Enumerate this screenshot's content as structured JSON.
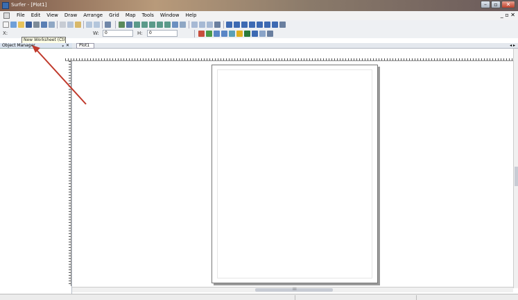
{
  "window": {
    "title": "Surfer - [Plot1]",
    "controls": {
      "minimize": "–",
      "maximize": "▫",
      "close": "✕"
    }
  },
  "menubar": {
    "items": [
      "File",
      "Edit",
      "View",
      "Draw",
      "Arrange",
      "Grid",
      "Map",
      "Tools",
      "Window",
      "Help"
    ],
    "mdi_controls": "_ ▫ ✕"
  },
  "toolbar2": {
    "x_label": "X:",
    "w_label": "W:",
    "w_value": "0",
    "h_label": "H:",
    "h_value": "0"
  },
  "tooltip": {
    "text": "New Worksheet (Ctrl+W)"
  },
  "object_manager": {
    "title": "Object Manager",
    "pin": "ᵩ",
    "close": "✕"
  },
  "document": {
    "tab_label": "Plot1",
    "tab_scroll": "◂ ▸"
  },
  "colors": {
    "annotation_arrow": "#c0392b",
    "page_border": "#777777"
  }
}
